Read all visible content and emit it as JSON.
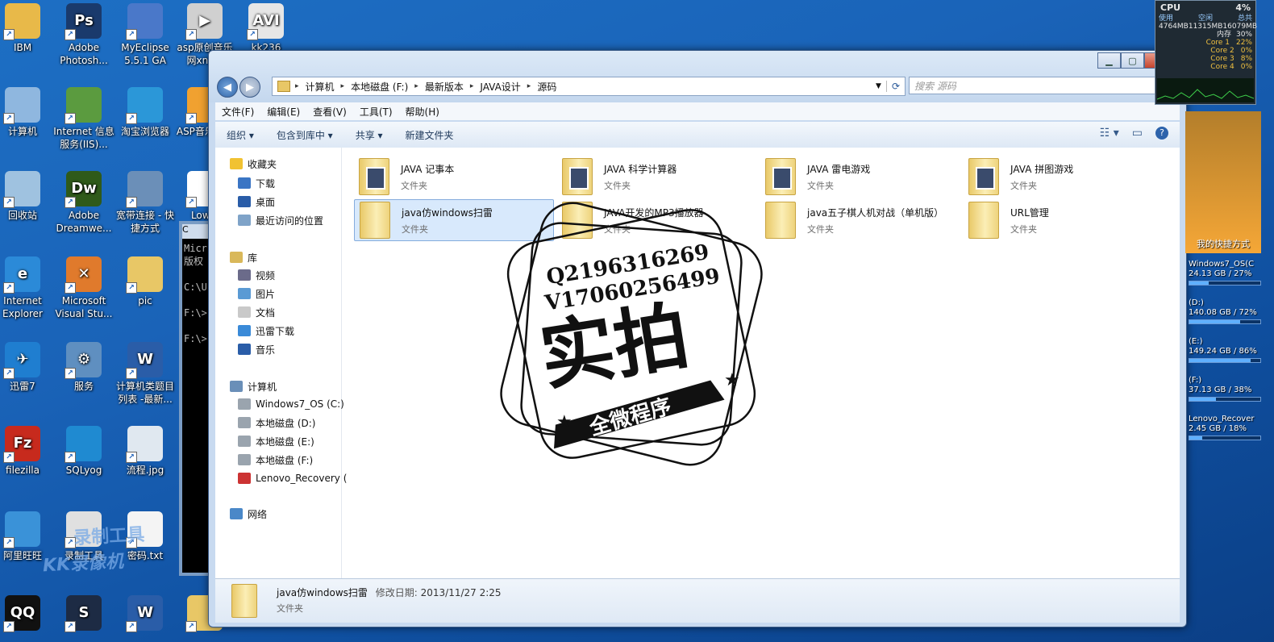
{
  "desktop": {
    "icons": [
      {
        "label": "IBM",
        "color": "#e8b949",
        "glyph": ""
      },
      {
        "label": "Adobe Photosh...",
        "color": "#1a3a6c",
        "glyph": "Ps"
      },
      {
        "label": "MyEclipse 5.5.1 GA",
        "color": "#4a78c9",
        "glyph": ""
      },
      {
        "label": "asp原创音乐网xns美",
        "color": "#d0d0d0",
        "glyph": "▶"
      },
      {
        "label": "kk236",
        "color": "#e6e6e6",
        "glyph": "AVI"
      },
      {
        "label": "计算机",
        "color": "#8fb7df",
        "glyph": ""
      },
      {
        "label": "Internet 信息服务(IIS)...",
        "color": "#5b9b3f",
        "glyph": ""
      },
      {
        "label": "淘宝浏览器",
        "color": "#2b97d8",
        "glyph": ""
      },
      {
        "label": "ASP音乐站.e",
        "color": "#f0a130",
        "glyph": ""
      },
      {
        "label": "回收站",
        "color": "#9fc2e0",
        "glyph": ""
      },
      {
        "label": "Adobe Dreamwe...",
        "color": "#2f5a1a",
        "glyph": "Dw"
      },
      {
        "label": "宽带连接 - 快捷方式",
        "color": "#6b8fb8",
        "glyph": ""
      },
      {
        "label": "Lowly",
        "color": "#ffffff",
        "glyph": ""
      },
      {
        "label": "Internet Explorer",
        "color": "#2b8ad8",
        "glyph": "e"
      },
      {
        "label": "Microsoft Visual Stu...",
        "color": "#e07a2c",
        "glyph": "✕"
      },
      {
        "label": "pic",
        "color": "#e8c766",
        "glyph": ""
      },
      {
        "label": "迅雷7",
        "color": "#1f7ed0",
        "glyph": "✈"
      },
      {
        "label": "服务",
        "color": "#5f8fc0",
        "glyph": "⚙"
      },
      {
        "label": "计算机类题目列表 -最新...",
        "color": "#2a5da8",
        "glyph": "W"
      },
      {
        "label": "filezilla",
        "color": "#c72a1d",
        "glyph": "Fz"
      },
      {
        "label": "SQLyog",
        "color": "#1f8ad1",
        "glyph": ""
      },
      {
        "label": "流程.jpg",
        "color": "#e0e8f0",
        "glyph": ""
      },
      {
        "label": "阿里旺旺",
        "color": "#3a92d8",
        "glyph": ""
      },
      {
        "label": "录制工具",
        "color": "#e0e0e0",
        "glyph": ""
      },
      {
        "label": "密码.txt",
        "color": "#f4f4f4",
        "glyph": ""
      },
      {
        "label": "",
        "color": "#111",
        "glyph": "QQ"
      },
      {
        "label": "",
        "color": "#1d2b44",
        "glyph": "S"
      },
      {
        "label": "",
        "color": "#2a5da8",
        "glyph": "W"
      },
      {
        "label": "",
        "color": "#e8c766",
        "glyph": ""
      }
    ]
  },
  "cmd": {
    "title": "C",
    "lines": [
      "Micr",
      "版权",
      "",
      "C:\\U",
      "",
      "F:\\>",
      "",
      "F:\\>"
    ]
  },
  "explorer": {
    "address": [
      "计算机",
      "本地磁盘 (F:)",
      "最新版本",
      "JAVA设计",
      "源码"
    ],
    "search_placeholder": "搜索 源码",
    "menu": [
      "文件(F)",
      "编辑(E)",
      "查看(V)",
      "工具(T)",
      "帮助(H)"
    ],
    "toolbar": [
      "组织 ▾",
      "包含到库中 ▾",
      "共享 ▾",
      "新建文件夹"
    ],
    "sidebar": {
      "favorites": "收藏夹",
      "fav_items": [
        "下载",
        "桌面",
        "最近访问的位置"
      ],
      "libraries": "库",
      "lib_items": [
        "视频",
        "图片",
        "文档",
        "迅雷下载",
        "音乐"
      ],
      "computer": "计算机",
      "drives": [
        "Windows7_OS (C:)",
        "本地磁盘 (D:)",
        "本地磁盘 (E:)",
        "本地磁盘 (F:)",
        "Lenovo_Recovery ("
      ],
      "network": "网络"
    },
    "folders": [
      {
        "name": "JAVA 记事本",
        "type": "文件夹"
      },
      {
        "name": "JAVA 科学计算器",
        "type": "文件夹"
      },
      {
        "name": "JAVA 雷电游戏",
        "type": "文件夹"
      },
      {
        "name": "JAVA 拼图游戏",
        "type": "文件夹"
      },
      {
        "name": "java仿windows扫雷",
        "type": "文件夹"
      },
      {
        "name": "JAVA开发的MP3播放器",
        "type": "文件夹"
      },
      {
        "name": "java五子棋人机对战（单机版）",
        "type": "文件夹"
      },
      {
        "name": "URL管理",
        "type": "文件夹"
      }
    ],
    "details": {
      "name": "java仿windows扫雷",
      "modified_label": "修改日期:",
      "modified": "2013/11/27 2:25",
      "type": "文件夹"
    }
  },
  "cpu_gadget": {
    "title": "CPU",
    "percent": "4%",
    "labels": [
      "使用",
      "空闲",
      "总共"
    ],
    "values": [
      "4764MB",
      "11315MB",
      "16079MB"
    ],
    "mem_label": "内存",
    "mem_percent": "30%",
    "cores": [
      {
        "name": "Core 1",
        "value": "22%"
      },
      {
        "name": "Core 2",
        "value": "0%"
      },
      {
        "name": "Core 3",
        "value": "8%"
      },
      {
        "name": "Core 4",
        "value": "0%"
      }
    ]
  },
  "shortcut_gadget": {
    "title": "我的快捷方式"
  },
  "drive_gadget": [
    {
      "name": "Windows7_OS(C",
      "info": "24.13 GB / 27%",
      "pct": 27
    },
    {
      "name": "(D:)",
      "info": "140.08 GB / 72%",
      "pct": 72
    },
    {
      "name": "(E:)",
      "info": "149.24 GB / 86%",
      "pct": 86
    },
    {
      "name": "(F:)",
      "info": "37.13 GB / 38%",
      "pct": 38
    },
    {
      "name": "Lenovo_Recover",
      "info": "2.45 GB / 18%",
      "pct": 18
    }
  ],
  "stamp": {
    "line1": "Q2196316269",
    "line2": "V1706025649​9",
    "main": "实拍",
    "sub": "全微程序"
  },
  "watermark": {
    "line1": "录制工具",
    "line2": "KK录像机"
  }
}
